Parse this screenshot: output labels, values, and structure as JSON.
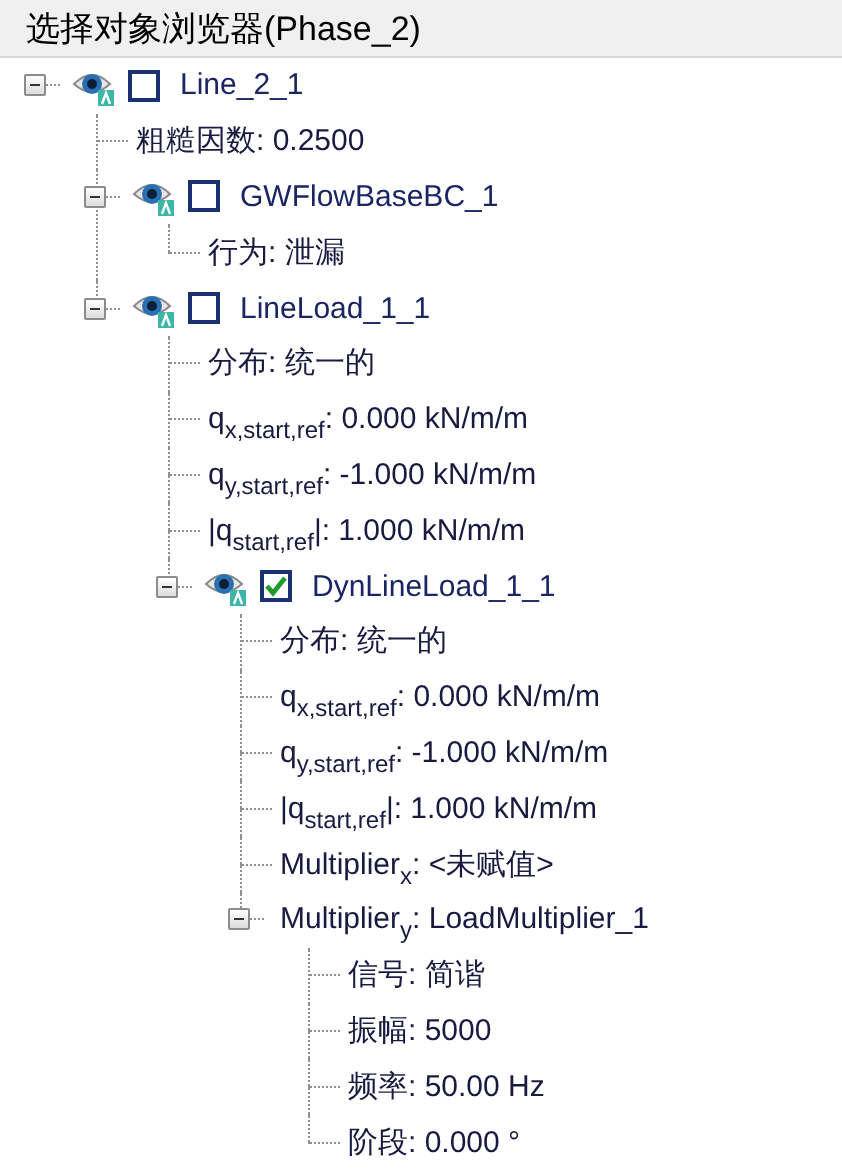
{
  "panel": {
    "title": "选择对象浏览器(Phase_2)"
  },
  "tree": [
    {
      "kind": "object",
      "name": "Line_2_1",
      "expanded": true,
      "checked": false,
      "children": [
        {
          "kind": "property",
          "label": "粗糙因数: 0.2500"
        },
        {
          "kind": "object",
          "name": "GWFlowBaseBC_1",
          "expanded": true,
          "checked": false,
          "children": [
            {
              "kind": "property",
              "label": "行为: 泄漏"
            }
          ]
        },
        {
          "kind": "object",
          "name": "LineLoad_1_1",
          "expanded": true,
          "checked": false,
          "children": [
            {
              "kind": "property",
              "label": "分布: 统一的"
            },
            {
              "kind": "property",
              "label": "q$_{x,start,ref}$: 0.000 kN/m/m"
            },
            {
              "kind": "property",
              "label": "q$_{y,start,ref}$: -1.000 kN/m/m"
            },
            {
              "kind": "property",
              "label": "|q$_{start,ref}$|: 1.000 kN/m/m"
            },
            {
              "kind": "object",
              "name": "DynLineLoad_1_1",
              "expanded": true,
              "checked": true,
              "children": [
                {
                  "kind": "property",
                  "label": "分布: 统一的"
                },
                {
                  "kind": "property",
                  "label": "q$_{x,start,ref}$: 0.000 kN/m/m"
                },
                {
                  "kind": "property",
                  "label": "q$_{y,start,ref}$: -1.000 kN/m/m"
                },
                {
                  "kind": "property",
                  "label": "|q$_{start,ref}$|: 1.000 kN/m/m"
                },
                {
                  "kind": "property",
                  "label": "Multiplier$_{x}$: <未赋值>"
                },
                {
                  "kind": "property",
                  "label": "Multiplier$_{y}$: LoadMultiplier_1",
                  "expanded": true,
                  "children": [
                    {
                      "kind": "property",
                      "label": "信号: 简谐"
                    },
                    {
                      "kind": "property",
                      "label": "振幅: 5000"
                    },
                    {
                      "kind": "property",
                      "label": "频率: 50.00 Hz"
                    },
                    {
                      "kind": "property",
                      "label": "阶段: 0.000 °"
                    }
                  ]
                }
              ]
            }
          ]
        }
      ]
    }
  ]
}
